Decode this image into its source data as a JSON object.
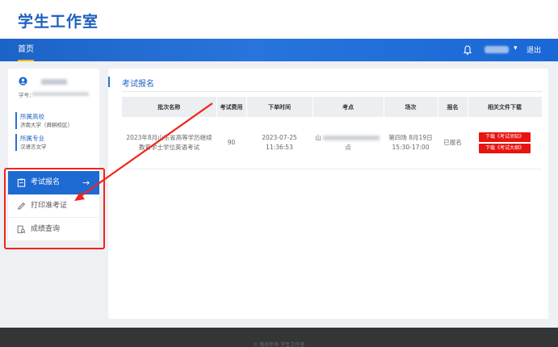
{
  "app": {
    "title": "学生工作室"
  },
  "nav": {
    "home": "首页",
    "logout": "退出",
    "caret": "▾"
  },
  "profile": {
    "student_id_label": "学号：",
    "school_title": "所属高校",
    "school_value": "济南大学（舜耕校区）",
    "major_title": "所属专业",
    "major_value": "汉语言文学"
  },
  "menu": {
    "items": [
      {
        "label": "考试报名",
        "icon": "clipboard-icon",
        "active": true,
        "arrow": "→"
      },
      {
        "label": "打印准考证",
        "icon": "pencil-icon",
        "active": false
      },
      {
        "label": "成绩查询",
        "icon": "search-doc-icon",
        "active": false
      }
    ]
  },
  "main": {
    "section_title": "考试报名",
    "table": {
      "headers": [
        "批次名称",
        "考试费用",
        "下单时间",
        "考点",
        "场次",
        "报名",
        "相关文件下载"
      ],
      "rows": [
        {
          "batch": "2023年8月山东省高等学历继续教育学士学位英语考试",
          "fee": "90",
          "order_time": "2023-07-25 11:36:53",
          "site_prefix": "山",
          "site_suffix": "点",
          "session": "第四场 8月19日 15:30-17:00",
          "status": "已报名",
          "downloads": [
            "下载《考试须知》",
            "下载《考试大纲》"
          ]
        }
      ]
    }
  },
  "footer": {
    "text": "© 版权所有 学生工作室"
  },
  "colors": {
    "brand": "#1d6ad2",
    "accent": "#f5b700",
    "annotation": "#f0251b",
    "download": "#e8140f"
  }
}
